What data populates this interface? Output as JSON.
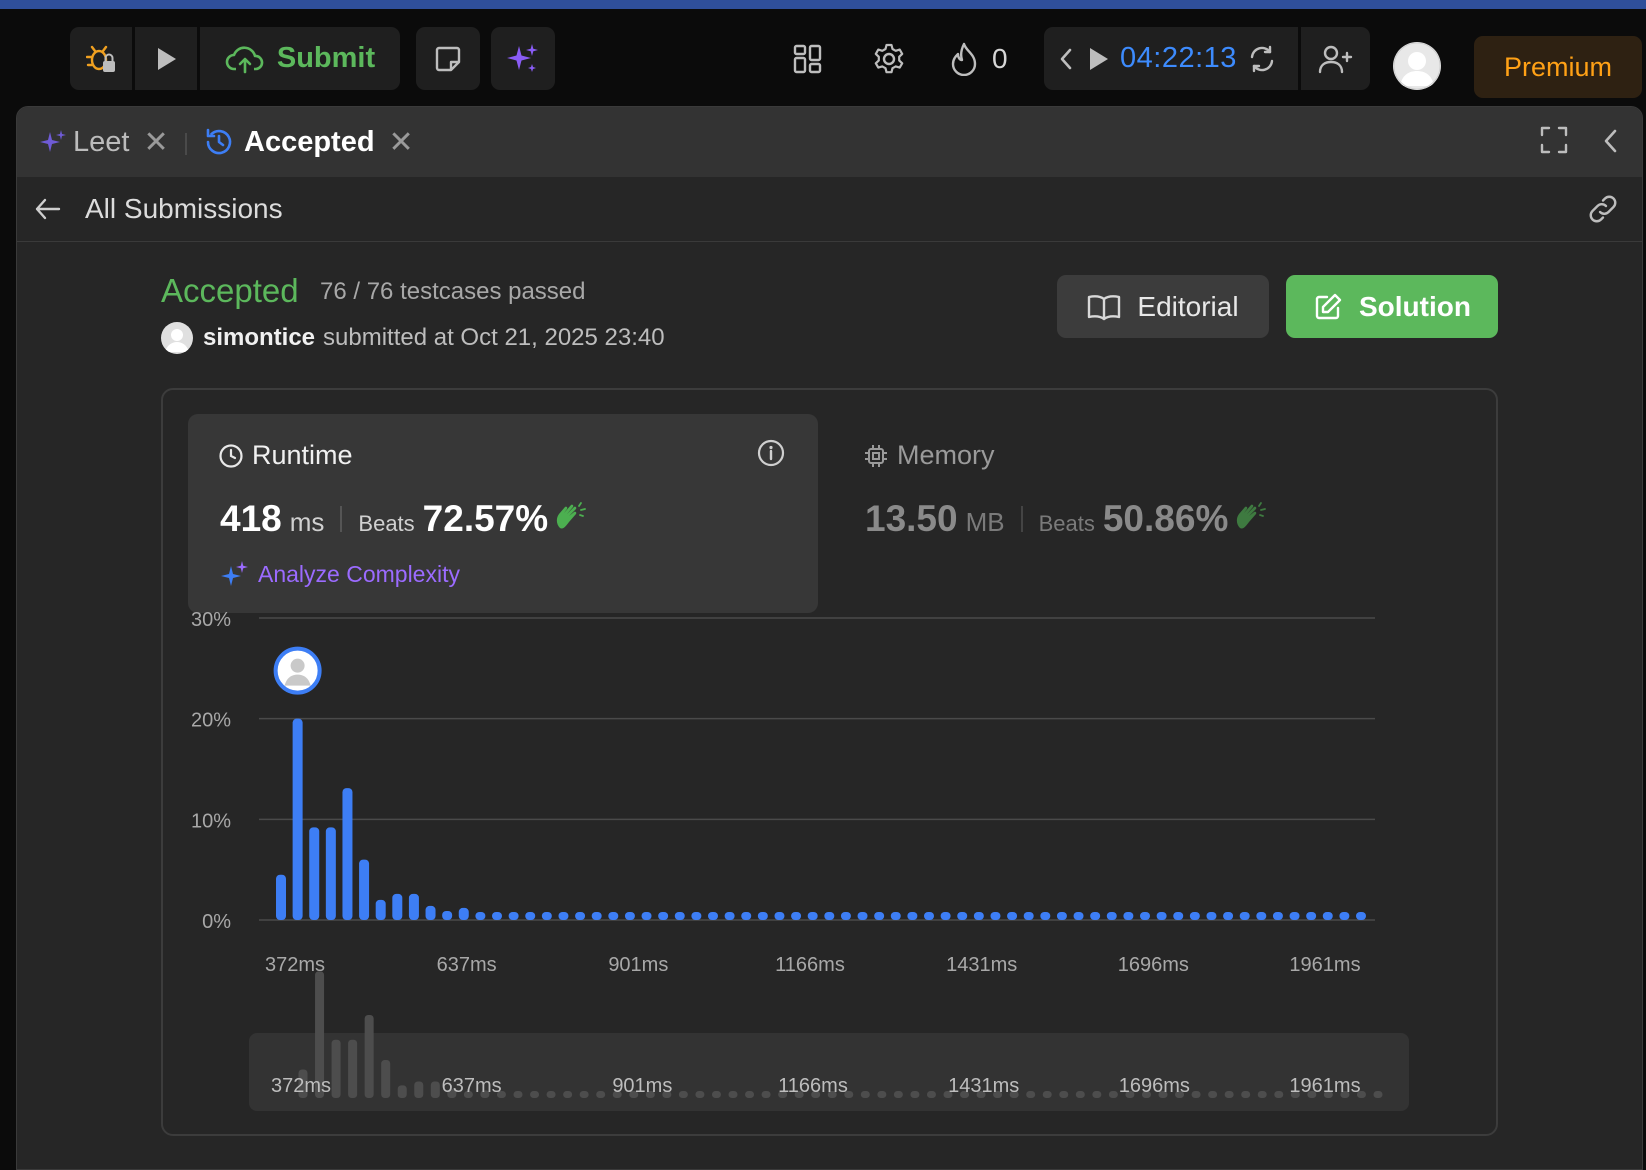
{
  "toolbar": {
    "submit_label": "Submit",
    "streak_count": "0",
    "timer": "04:22:13",
    "premium_label": "Premium"
  },
  "tabs": [
    {
      "label": "Leet"
    },
    {
      "label": "Accepted"
    }
  ],
  "subheader": {
    "title": "All Submissions"
  },
  "submission": {
    "status": "Accepted",
    "testcases": "76 / 76 testcases passed",
    "username": "simontice",
    "submitted_at": "submitted at Oct 21, 2025 23:40",
    "editorial_label": "Editorial",
    "solution_label": "Solution"
  },
  "runtime": {
    "label": "Runtime",
    "value": "418",
    "unit": "ms",
    "beats_label": "Beats",
    "beats": "72.57%",
    "analyze_label": "Analyze Complexity"
  },
  "memory": {
    "label": "Memory",
    "value": "13.50",
    "unit": "MB",
    "beats_label": "Beats",
    "beats": "50.86%"
  },
  "colors": {
    "accent_green": "#5cb85c",
    "accent_blue": "#3d7ef5",
    "accent_purple": "#9b6bff",
    "premium_orange": "#ffa116"
  },
  "chart_data": {
    "type": "bar",
    "title": "",
    "xlabel": "",
    "ylabel": "",
    "ylim": [
      0,
      30
    ],
    "y_ticks": [
      "0%",
      "10%",
      "20%",
      "30%"
    ],
    "y_tick_values": [
      0,
      10,
      20,
      30
    ],
    "x_tick_labels": [
      "372ms",
      "637ms",
      "901ms",
      "1166ms",
      "1431ms",
      "1696ms",
      "1961ms"
    ],
    "highlight_index": 1,
    "values": [
      4.5,
      20,
      9.2,
      9.2,
      13.1,
      6,
      2,
      2.6,
      2.6,
      1.4,
      0.9,
      1.2,
      0.8,
      0.8,
      0.8,
      0.8,
      0.8,
      0.8,
      0.8,
      0.8,
      0.8,
      0.8,
      0.8,
      0.8,
      0.8,
      0.8,
      0.8,
      0.8,
      0.8,
      0.8,
      0.8,
      0.8,
      0.8,
      0.8,
      0.8,
      0.8,
      0.8,
      0.8,
      0.8,
      0.8,
      0.8,
      0.8,
      0.8,
      0.8,
      0.8,
      0.8,
      0.8,
      0.8,
      0.8,
      0.8,
      0.8,
      0.8,
      0.8,
      0.8,
      0.8,
      0.8,
      0.8,
      0.8,
      0.8,
      0.8,
      0.8,
      0.8,
      0.8,
      0.8,
      0.8,
      0.8
    ]
  }
}
